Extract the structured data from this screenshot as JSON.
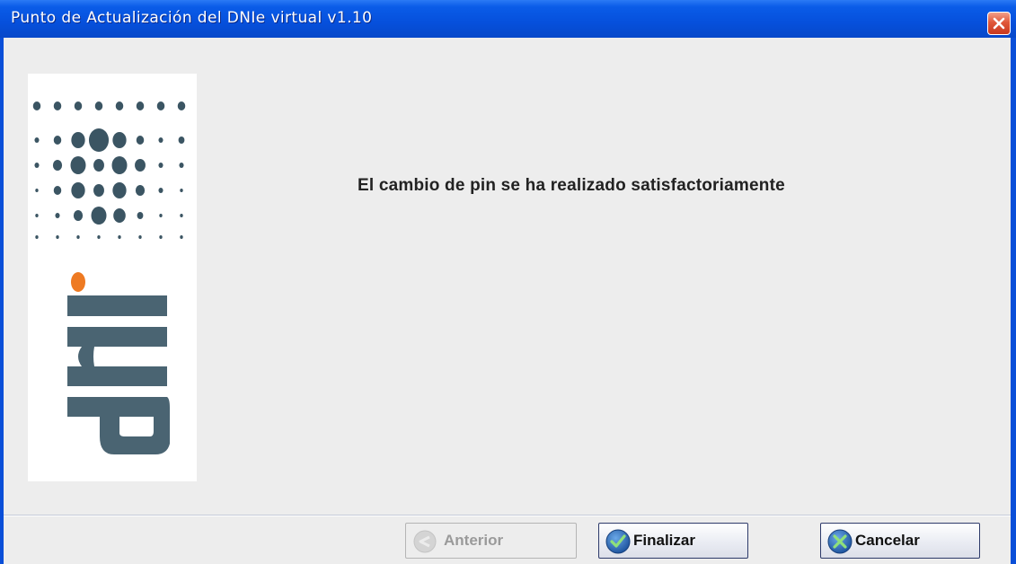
{
  "window": {
    "title": "Punto de Actualización del DNIe virtual v1.10"
  },
  "logo": {
    "text": "dni"
  },
  "main": {
    "message": "El cambio de pin se ha realizado satisfactoriamente"
  },
  "buttons": {
    "previous_label": "Anterior",
    "finish_label": "Finalizar",
    "cancel_label": "Cancelar"
  },
  "icons": {
    "close": "close-icon",
    "previous": "arrow-left-icon",
    "finish": "checkmark-icon",
    "cancel": "cancel-x-icon"
  },
  "colors": {
    "titlebar": "#0650dc",
    "client_background": "#ededed",
    "logo_dots": "#3b5563",
    "logo_letters": "#4a6472",
    "logo_accent": "#ee7a22"
  }
}
